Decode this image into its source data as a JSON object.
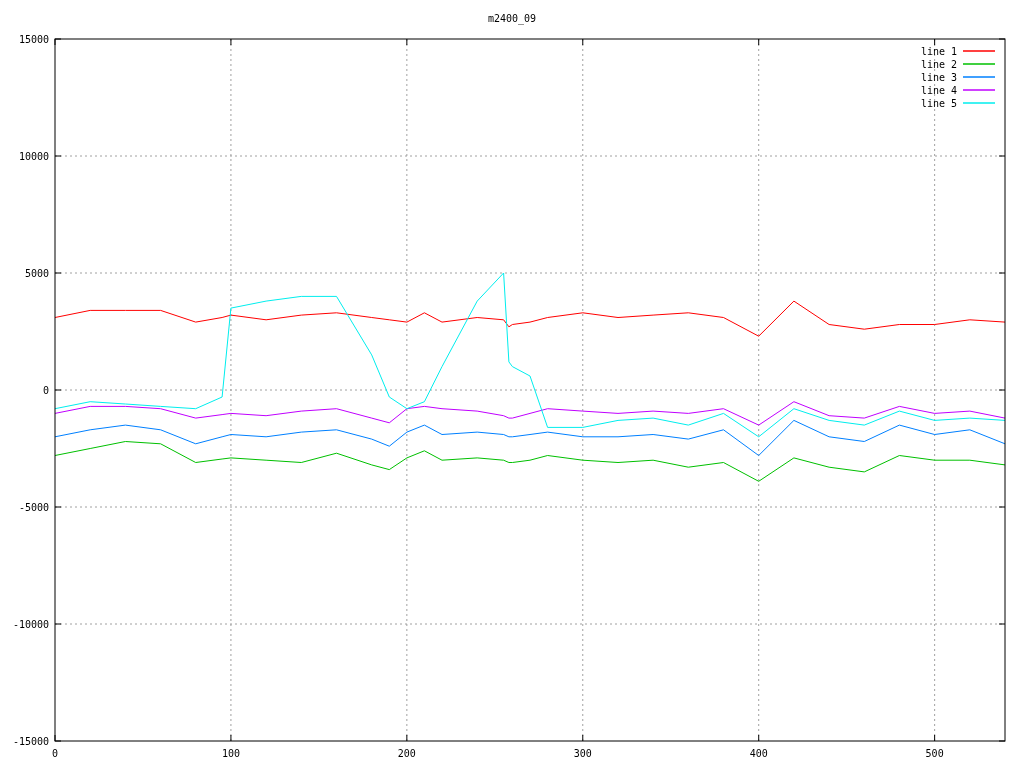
{
  "chart_data": {
    "type": "line",
    "title": "m2400_09",
    "x": [
      0,
      20,
      40,
      60,
      80,
      95,
      100,
      120,
      140,
      160,
      180,
      190,
      200,
      210,
      220,
      240,
      255,
      258,
      260,
      270,
      280,
      300,
      320,
      340,
      360,
      380,
      400,
      420,
      440,
      460,
      480,
      500,
      520,
      540
    ],
    "series": [
      {
        "name": "line 1",
        "color": "#ff0000",
        "values": [
          3100,
          3400,
          3400,
          3400,
          2900,
          3100,
          3200,
          3000,
          3200,
          3300,
          3100,
          3000,
          2900,
          3300,
          2900,
          3100,
          3000,
          2700,
          2800,
          2900,
          3100,
          3300,
          3100,
          3200,
          3300,
          3100,
          2300,
          3800,
          2800,
          2600,
          2800,
          2800,
          3000,
          2900
        ]
      },
      {
        "name": "line 2",
        "color": "#00c000",
        "values": [
          -2800,
          -2500,
          -2200,
          -2300,
          -3100,
          -2950,
          -2900,
          -3000,
          -3100,
          -2700,
          -3200,
          -3400,
          -2900,
          -2600,
          -3000,
          -2900,
          -3000,
          -3100,
          -3100,
          -3000,
          -2800,
          -3000,
          -3100,
          -3000,
          -3300,
          -3100,
          -3900,
          -2900,
          -3300,
          -3500,
          -2800,
          -3000,
          -3000,
          -3200
        ]
      },
      {
        "name": "line 3",
        "color": "#0080ff",
        "values": [
          -2000,
          -1700,
          -1500,
          -1700,
          -2300,
          -2000,
          -1900,
          -2000,
          -1800,
          -1700,
          -2100,
          -2400,
          -1800,
          -1500,
          -1900,
          -1800,
          -1900,
          -2000,
          -2000,
          -1900,
          -1800,
          -2000,
          -2000,
          -1900,
          -2100,
          -1700,
          -2800,
          -1300,
          -2000,
          -2200,
          -1500,
          -1900,
          -1700,
          -2300
        ]
      },
      {
        "name": "line 4",
        "color": "#c000ff",
        "values": [
          -1000,
          -700,
          -700,
          -800,
          -1200,
          -1050,
          -1000,
          -1100,
          -900,
          -800,
          -1200,
          -1400,
          -800,
          -700,
          -800,
          -900,
          -1100,
          -1200,
          -1200,
          -1000,
          -800,
          -900,
          -1000,
          -900,
          -1000,
          -800,
          -1500,
          -500,
          -1100,
          -1200,
          -700,
          -1000,
          -900,
          -1200
        ]
      },
      {
        "name": "line 5",
        "color": "#00eeee",
        "values": [
          -800,
          -500,
          -600,
          -700,
          -800,
          -300,
          3500,
          3800,
          4000,
          4000,
          1500,
          -300,
          -800,
          -500,
          1000,
          3800,
          5000,
          1200,
          1000,
          600,
          -1600,
          -1600,
          -1300,
          -1200,
          -1500,
          -1000,
          -2000,
          -800,
          -1300,
          -1500,
          -900,
          -1300,
          -1200,
          -1300
        ]
      }
    ],
    "grid": true,
    "legend": true,
    "xlim": [
      0,
      540
    ],
    "ylim": [
      -15000,
      15000
    ],
    "xticks": [
      0,
      100,
      200,
      300,
      400,
      500
    ],
    "yticks": [
      -15000,
      -10000,
      -5000,
      0,
      5000,
      10000,
      15000
    ]
  }
}
